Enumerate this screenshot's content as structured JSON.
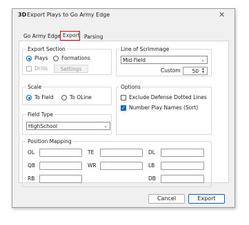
{
  "window": {
    "icon_text": "3D",
    "title": "Export Plays to Go Army Edge",
    "close_glyph": "✕"
  },
  "tabs": [
    {
      "label": "Go Army Edge"
    },
    {
      "label": "Export"
    },
    {
      "label": "Parsing"
    }
  ],
  "export_section": {
    "label": "Export Section",
    "plays_label": "Plays",
    "formations_label": "Formations",
    "selected": "Plays",
    "drills_label": "Drills",
    "settings_label": "Settings"
  },
  "line_of_scrimmage": {
    "label": "Line of Scrimmage",
    "selected": "Mid Field",
    "custom_label": "Custom",
    "custom_value": "50"
  },
  "scale": {
    "label": "Scale",
    "to_field_label": "To Field",
    "to_oline_label": "To OLine",
    "selected": "To Field"
  },
  "options": {
    "label": "Options",
    "exclude_defense_label": "Exclude Defense Dotted Lines",
    "exclude_defense_checked": false,
    "number_plays_label": "Number Play Names (Sort)",
    "number_plays_checked": true
  },
  "field_type": {
    "label": "Field Type",
    "selected": "HighSchool"
  },
  "position_mapping": {
    "label": "Position Mapping",
    "rows": [
      [
        "OL",
        "TE",
        "DL"
      ],
      [
        "QB",
        "WR",
        "LB"
      ],
      [
        "RB",
        "",
        "DB"
      ]
    ]
  },
  "footer": {
    "cancel_label": "Cancel",
    "export_label": "Export"
  },
  "colors": {
    "accent": "#0067c0",
    "highlight": "#d90000"
  }
}
